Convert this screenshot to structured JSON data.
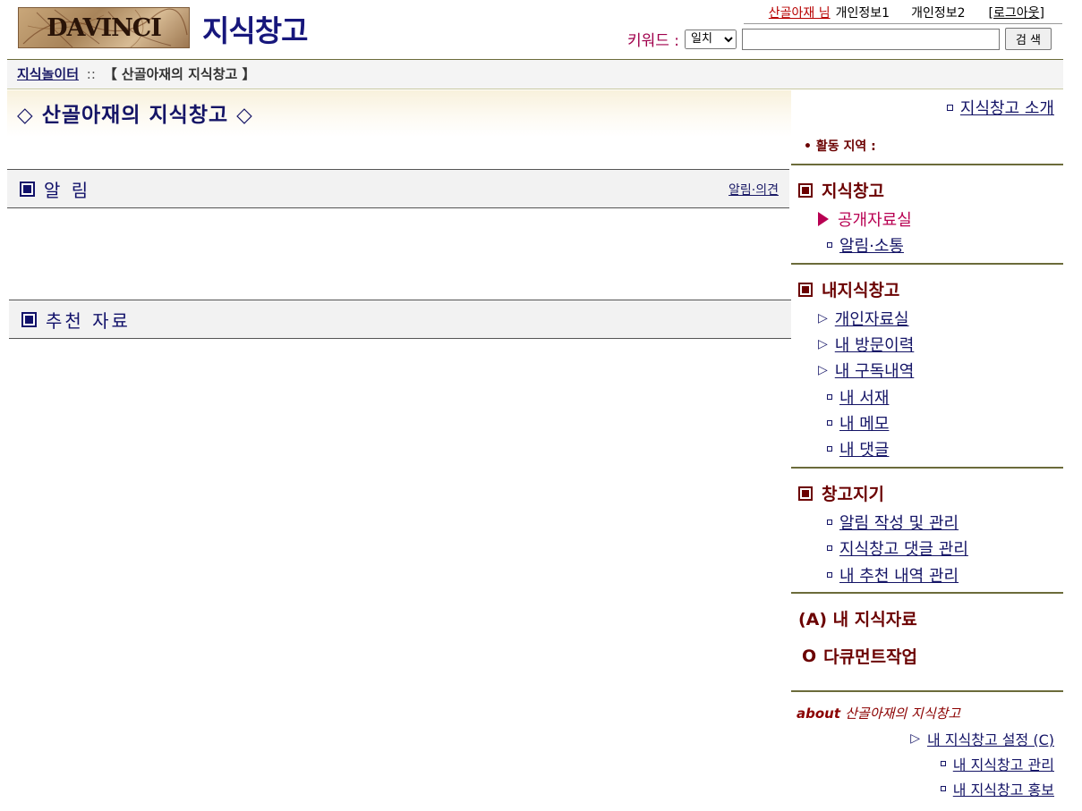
{
  "header": {
    "logo_text": "DAVINCI",
    "site_title": "지식창고",
    "user_name": "산골아재 님",
    "profile1": "개인정보1",
    "profile2": "개인정보2",
    "logout_label": "로그아웃",
    "logout_open": "[",
    "logout_close": "]"
  },
  "search": {
    "label": "키워드 :",
    "match_options": [
      "일치"
    ],
    "match_selected": "일치",
    "input_value": "",
    "button_label": "검 색"
  },
  "breadcrumb": {
    "home": "지식놀이터",
    "separator": "::",
    "current": "【 산골아재의 지식창고 】"
  },
  "main": {
    "heading": "◇ 산골아재의 지식창고 ◇",
    "notice": {
      "title": "알 림",
      "link": "알림·의견"
    },
    "recommend": {
      "title": "추천 자료"
    }
  },
  "sidebar": {
    "intro_link": "지식창고 소개",
    "activity_label": "• 활동 지역 :",
    "groups": [
      {
        "title": "지식창고",
        "items": [
          "공개자료실",
          "알림·소통"
        ]
      },
      {
        "title": "내지식창고",
        "items": [
          "개인자료실",
          "내 방문이력",
          "내 구독내역",
          "내 서재",
          "내 메모",
          "내 댓글"
        ]
      },
      {
        "title": "창고지기",
        "items": [
          "알림 작성 및 관리",
          "지식창고 댓글 관리",
          "내 추천 내역 관리"
        ]
      }
    ],
    "my_knowledge": "(A) 내 지식자료",
    "document_work_icon": "O",
    "document_work": "다큐먼트작업",
    "about_prefix": "about",
    "about_name": "산골아재의 지식창고",
    "settings_link": "내 지식창고 설정 (C)",
    "manage_link": "내 지식창고 관리",
    "promote_link": "내 지식창고 홍보"
  },
  "colors": {
    "navy": "#141466",
    "maroon": "#6b0000",
    "accent_pink": "#b80052",
    "rule_olive": "#6b6b3a",
    "user_red": "#b80000"
  }
}
